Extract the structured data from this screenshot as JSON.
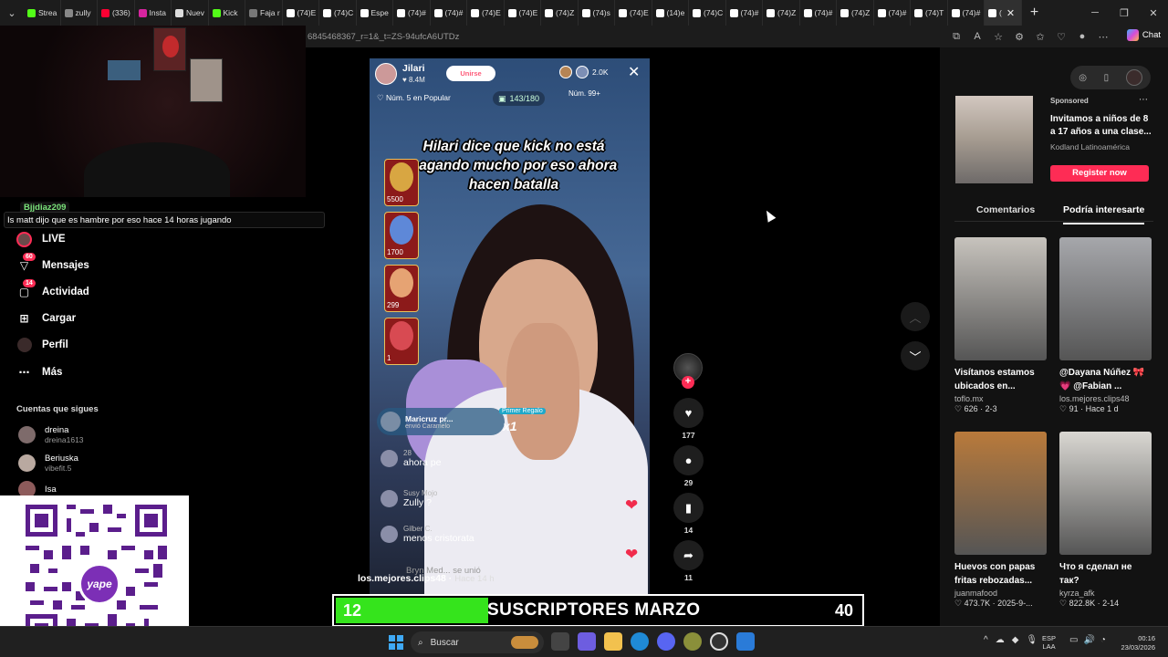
{
  "browser": {
    "tabs": [
      {
        "label": "Strea",
        "color": "#53fc18"
      },
      {
        "label": "zully",
        "color": "#888888"
      },
      {
        "label": "(336)",
        "color": "#ff0033"
      },
      {
        "label": "Insta",
        "color": "#d6249f"
      },
      {
        "label": "Nuev",
        "color": "#dddddd"
      },
      {
        "label": "Kick",
        "color": "#53fc18"
      },
      {
        "label": "Faja r",
        "color": "#777777"
      },
      {
        "label": "(74)E",
        "color": "#ffffff"
      },
      {
        "label": "(74)C",
        "color": "#ffffff"
      },
      {
        "label": "Espe",
        "color": "#ffffff"
      },
      {
        "label": "(74)#",
        "color": "#ffffff"
      },
      {
        "label": "(74)#",
        "color": "#ffffff"
      },
      {
        "label": "(74)E",
        "color": "#ffffff"
      },
      {
        "label": "(74)E",
        "color": "#ffffff"
      },
      {
        "label": "(74)Z",
        "color": "#ffffff"
      },
      {
        "label": "(74)s",
        "color": "#ffffff"
      },
      {
        "label": "(74)E",
        "color": "#ffffff"
      },
      {
        "label": "(14)e",
        "color": "#ffffff"
      },
      {
        "label": "(74)C",
        "color": "#ffffff"
      },
      {
        "label": "(74)#",
        "color": "#ffffff"
      },
      {
        "label": "(74)Z",
        "color": "#ffffff"
      },
      {
        "label": "(74)#",
        "color": "#ffffff"
      },
      {
        "label": "(74)Z",
        "color": "#ffffff"
      },
      {
        "label": "(74)#",
        "color": "#ffffff"
      },
      {
        "label": "(74)T",
        "color": "#ffffff"
      },
      {
        "label": "(74)#",
        "color": "#ffffff"
      },
      {
        "label": "(",
        "color": "#ffffff",
        "active": true
      }
    ],
    "new_tab": "+",
    "url": "6845468367_r=1&_t=ZS-94ufcA6UTDz",
    "chat_label": "Chat"
  },
  "overlay": {
    "chat_user": "Bjjdiaz209",
    "chat_message": "Is matt dijo que es hambre por eso hace 14 horas jugando"
  },
  "sidebar": {
    "items": [
      {
        "label": "LIVE",
        "icon": "live-icon"
      },
      {
        "label": "Mensajes",
        "icon": "messages-icon",
        "badge": "60"
      },
      {
        "label": "Actividad",
        "icon": "activity-icon",
        "badge": "14"
      },
      {
        "label": "Cargar",
        "icon": "upload-icon"
      },
      {
        "label": "Perfil",
        "icon": "profile-icon"
      },
      {
        "label": "Más",
        "icon": "more-icon"
      }
    ],
    "following_title": "Cuentas que sigues",
    "following": [
      {
        "name": "dreina",
        "handle": "dreina1613"
      },
      {
        "name": "Beriuska",
        "handle": "vibefit.5"
      },
      {
        "name": "Isa",
        "handle": ""
      }
    ]
  },
  "qr": {
    "brand": "yape"
  },
  "live": {
    "host_name": "Jilari",
    "host_likes": "8.4M",
    "join_label": "Unirse",
    "viewers": "2.0K",
    "rank_popular": "Núm. 5 en Popular",
    "progress": "143/180",
    "rank_other": "Núm. 99+",
    "caption": "Hilari dice que kick no está pagando mucho por eso ahora hacen batalla",
    "gifts": [
      "5500",
      "1700",
      "299",
      "1"
    ],
    "first_gift_user": "Maricruz pr...",
    "first_gift_sub": "envió Caramelo",
    "first_gift_tag": "Primer Regalo",
    "first_gift_mult": "x1",
    "comments": [
      {
        "name": "28",
        "text": "ahora pe"
      },
      {
        "name": "Susy Mojo",
        "text": "Zully ?"
      },
      {
        "name": "Gilber C.",
        "text": "menos cristorata"
      }
    ],
    "joined": "Bryn Med... se unió"
  },
  "post": {
    "username": "los.mejores.clips48",
    "time": "Hace 14 h",
    "likes": "177",
    "comments": "29",
    "saves": "14",
    "shares": "11"
  },
  "subs_bar": {
    "current": "12",
    "title": "SUSCRIPTORES MARZO",
    "goal": "40",
    "fill_color": "#35e41c"
  },
  "right_panel": {
    "ad": {
      "sponsored": "Sponsored",
      "title": "Invitamos a niños de 8 a 17 años a una clase...",
      "company": "Kodland Latinoamérica",
      "button": "Register now"
    },
    "tabs": [
      "Comentarios",
      "Podría interesarte"
    ],
    "cards": [
      {
        "title": "Visítanos estamos ubicados en...",
        "user": "toflo.mx",
        "stats": "♡ 626 · 2-3",
        "color": "#c7c3bd"
      },
      {
        "title": "@Dayana Núñez 🎀💗 @Fabian ...",
        "user": "los.mejores.clips48",
        "stats": "♡ 91 · Hace 1 d",
        "color": "#a6a7ab"
      },
      {
        "title": "Huevos con papas fritas rebozadas...",
        "user": "juanmafood",
        "stats": "♡ 473.7K · 2025-9-...",
        "color": "#b97a3b"
      },
      {
        "title": "Что я сделал не так?",
        "user": "kyrza_afk",
        "stats": "♡ 822.8K · 2-14",
        "color": "#d9d7d2"
      }
    ]
  },
  "taskbar": {
    "search": "Buscar",
    "lang_line1": "ESP",
    "lang_line2": "LAA",
    "time": "00:16",
    "date": "23/03/2026"
  }
}
